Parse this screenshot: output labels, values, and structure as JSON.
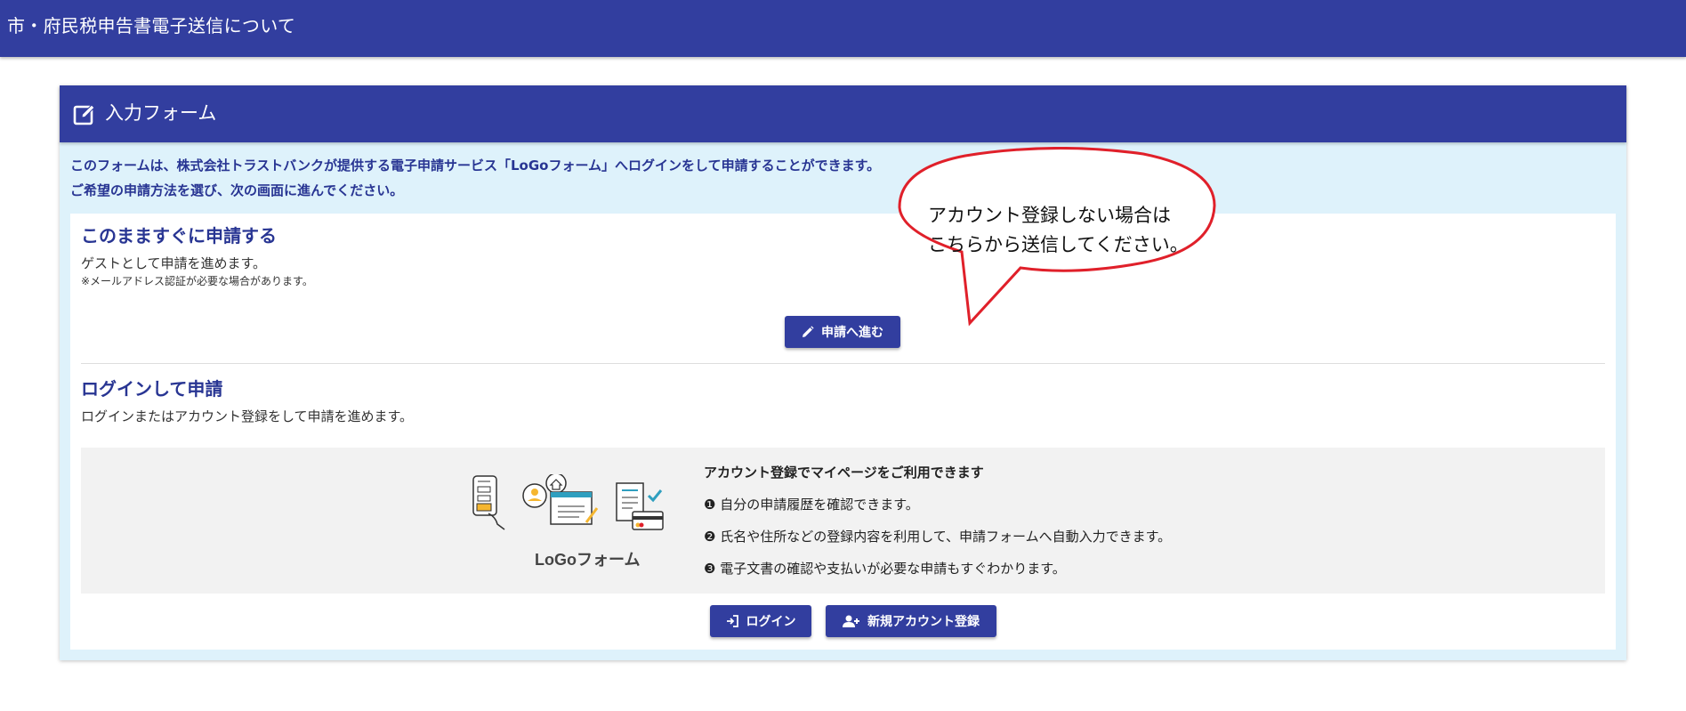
{
  "topbar": {
    "title": "市・府民税申告書電子送信について"
  },
  "card": {
    "header_title": "入力フォーム",
    "intro_lines": [
      "このフォームは、株式会社トラストバンクが提供する電子申請サービス「LoGoフォーム」へログインをして申請することができます。",
      "ご希望の申請方法を選び、次の画面に進んでください。"
    ],
    "guest": {
      "title": "このまますぐに申請する",
      "desc": "ゲストとして申請を進めます。",
      "note": "※メールアドレス認証が必要な場合があります。",
      "button_label": "申請へ進む"
    },
    "login": {
      "title": "ログインして申請",
      "desc": "ログインまたはアカウント登録をして申請を進めます。",
      "promo_heading": "アカウント登録でマイページをご利用できます",
      "promo_items": [
        "❶ 自分の申請履歴を確認できます。",
        "❷ 氏名や住所などの登録内容を利用して、申請フォームへ自動入力できます。",
        "❸ 電子文書の確認や支払いが必要な申請もすぐわかります。"
      ],
      "logo_text": "LoGoフォーム",
      "login_button_label": "ログイン",
      "register_button_label": "新規アカウント登録"
    }
  },
  "callout": {
    "lines": [
      "アカウント登録しない場合は",
      "こちらから送信してください。"
    ],
    "border_color": "#e0202a"
  },
  "colors": {
    "primary": "#323e9f",
    "card_background": "#def2fb",
    "heading_text": "#283593"
  }
}
